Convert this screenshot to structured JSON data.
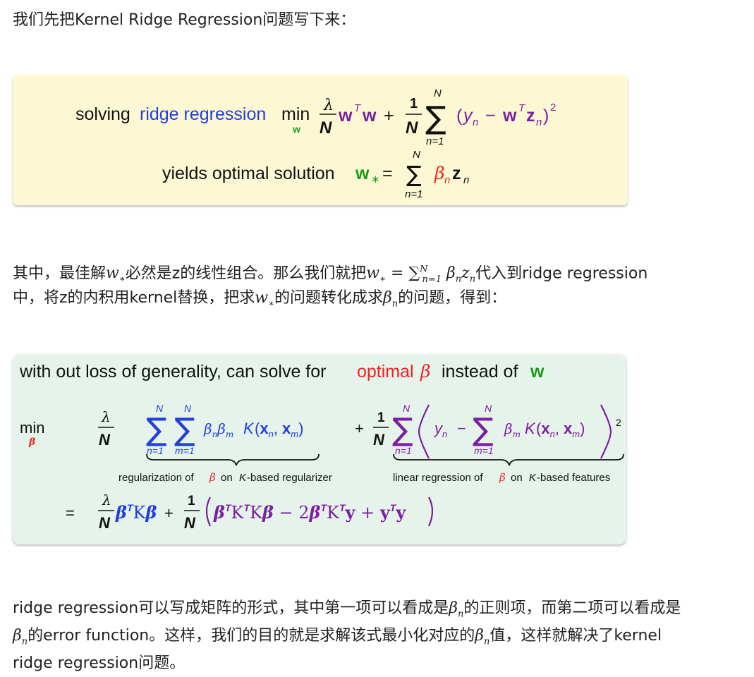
{
  "intro": "我们先把Kernel Ridge Regression问题写下来：",
  "box1": {
    "line1_prefix": "solving",
    "line1_mid": "ridge regression",
    "line2_prefix": "yields optimal solution"
  },
  "para2": {
    "seg1": "其中，最佳解",
    "seg2": "必然是z的线性组合。那么我们就把",
    "seg3": "代入到ridge regression",
    "line2_seg1": "中，将z的内积用kernel替换，把求",
    "line2_seg2": "的问题转化成求",
    "line2_seg3": "的问题，得到："
  },
  "box2": {
    "headline_1": "with out loss of generality, can solve for",
    "headline_2": "optimal",
    "headline_3": "instead of",
    "brace1_label_a": "regularization of",
    "brace1_label_b": "on",
    "brace1_label_c": "-based regularizer",
    "brace2_label_a": "linear regression of",
    "brace2_label_b": "on",
    "brace2_label_c": "-based features"
  },
  "para3": {
    "line1_a": "ridge regression可以写成矩阵的形式，其中第一项可以看成是",
    "line1_b": "的正则项，而第二项可以看成是",
    "line2_a": "的error function。这样，我们的目的就是求解该式最小化对应的",
    "line2_b": "值，这样就解决了kernel",
    "line3": "ridge regression问题。"
  },
  "colors": {
    "blue": "#1f3fe0",
    "purple": "#7a1fa2",
    "green": "#1a9a1a",
    "red": "#ee2222",
    "dark": "#111111"
  }
}
